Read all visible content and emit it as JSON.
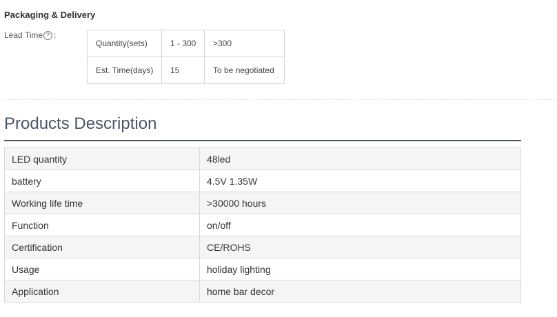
{
  "packaging": {
    "title": "Packaging & Delivery",
    "lead_time_label": "Lead Time",
    "help_glyph": "?",
    "colon": ":",
    "lead_table": [
      [
        "Quantity(sets)",
        "1 - 300",
        ">300"
      ],
      [
        "Est. Time(days)",
        "15",
        "To be negotiated"
      ]
    ]
  },
  "description": {
    "title": "Products Description",
    "rows": [
      [
        "LED quantity",
        "48led"
      ],
      [
        "battery",
        "4.5V 1.35W"
      ],
      [
        "Working life time",
        ">30000 hours"
      ],
      [
        "Function",
        "on/off"
      ],
      [
        "Certification",
        "CE/ROHS"
      ],
      [
        "Usage",
        "holiday lighting"
      ],
      [
        "Application",
        "home bar decor"
      ]
    ]
  },
  "colors": {
    "heading": "#4a5565",
    "row_alt": "#f5f5f5",
    "border": "#d9d9d9"
  }
}
